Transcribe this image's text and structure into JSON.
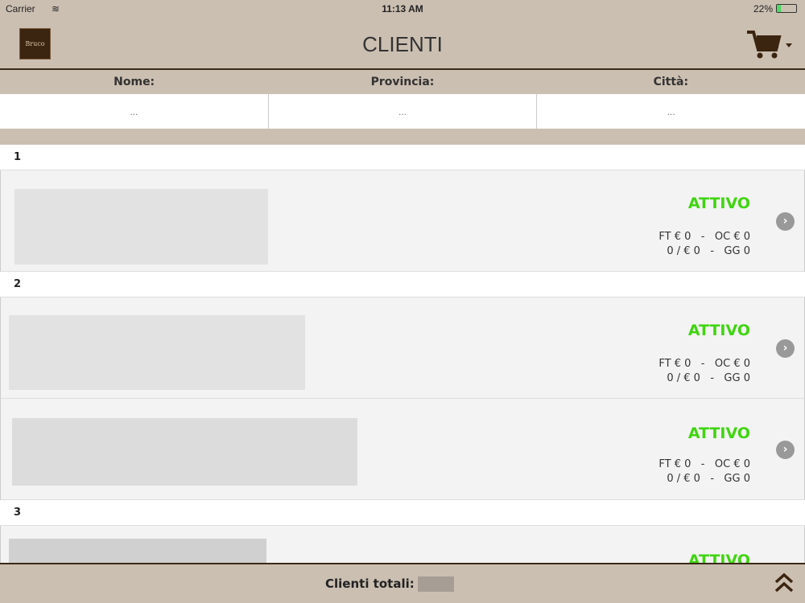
{
  "status": {
    "carrier": "Carrier",
    "time": "11:13 AM",
    "battery": "22%",
    "battery_level": 22
  },
  "nav": {
    "title": "CLIENTI",
    "logo_text": "Bruco"
  },
  "filters": {
    "labels": [
      "Nome:",
      "Provincia:",
      "Città:"
    ],
    "placeholders": [
      "...",
      "...",
      "..."
    ]
  },
  "groups": [
    {
      "label": "1"
    },
    {
      "label": "2"
    },
    {
      "label": "3"
    }
  ],
  "rows": [
    {
      "status": "ATTIVO",
      "line1": "FT € 0   -   OC € 0",
      "line2": "0 / € 0   -   GG 0"
    },
    {
      "status": "ATTIVO",
      "line1": "FT € 0   -   OC € 0",
      "line2": "0 / € 0   -   GG 0"
    },
    {
      "status": "ATTIVO",
      "line1": "FT € 0   -   OC € 0",
      "line2": "0 / € 0   -   GG 0"
    },
    {
      "status": "ATTIVO"
    }
  ],
  "footer": {
    "label": "Clienti totali:"
  }
}
